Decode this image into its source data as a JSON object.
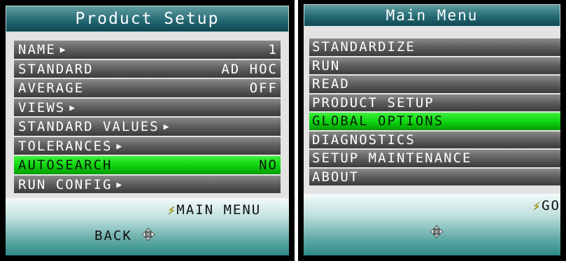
{
  "left_screen": {
    "title": "Product Setup",
    "items": [
      {
        "label": "NAME",
        "arrow": "▶",
        "value": "1"
      },
      {
        "label": "STANDARD",
        "arrow": "",
        "value": "AD HOC"
      },
      {
        "label": "AVERAGE",
        "arrow": "",
        "value": "OFF"
      },
      {
        "label": "VIEWS",
        "arrow": "▶",
        "value": ""
      },
      {
        "label": "STANDARD VALUES",
        "arrow": "▶",
        "value": ""
      },
      {
        "label": "TOLERANCES",
        "arrow": "▶",
        "value": ""
      },
      {
        "label": "AUTOSEARCH",
        "arrow": "",
        "value": "NO"
      },
      {
        "label": "RUN CONFIG",
        "arrow": "▶",
        "value": ""
      }
    ],
    "highlighted_index": 6,
    "softkeys": {
      "right": "MAIN MENU",
      "left": "BACK"
    }
  },
  "right_screen": {
    "title": "Main Menu",
    "items": [
      {
        "label": "STANDARDIZE"
      },
      {
        "label": "RUN"
      },
      {
        "label": "READ"
      },
      {
        "label": "PRODUCT SETUP"
      },
      {
        "label": "GLOBAL OPTIONS"
      },
      {
        "label": "DIAGNOSTICS"
      },
      {
        "label": "SETUP MAINTENANCE"
      },
      {
        "label": "ABOUT"
      }
    ],
    "highlighted_index": 4,
    "softkeys": {
      "right": "GO"
    }
  },
  "icons": {
    "softkey": "lightning-bolt-icon",
    "navigation": "dpad-icon"
  },
  "colors": {
    "highlight": "#1ee01e",
    "title_bar": "#256a74",
    "item_bg": "#616161",
    "bolt": "#f3e000"
  }
}
